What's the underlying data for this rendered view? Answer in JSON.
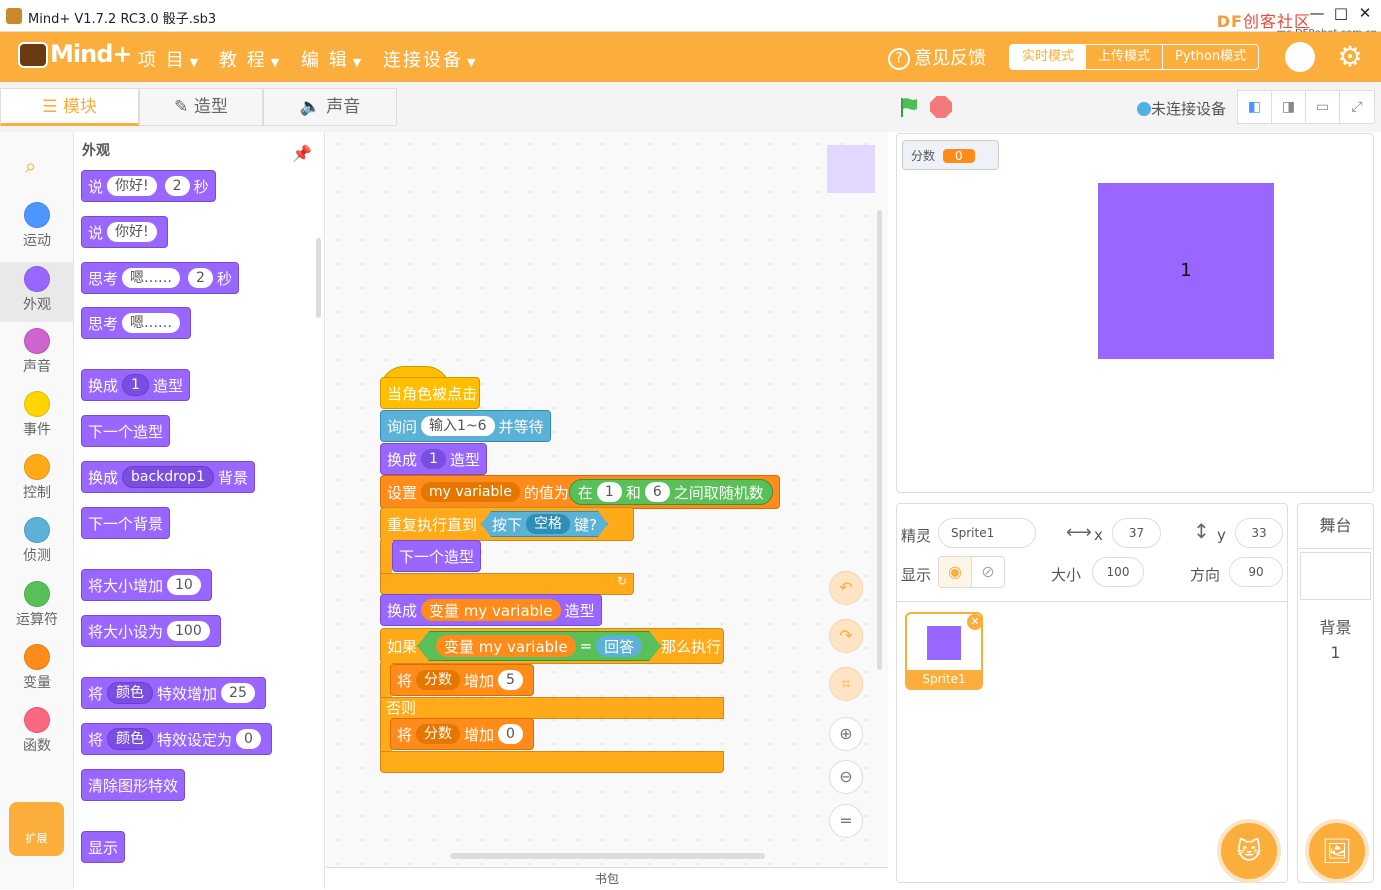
{
  "window": {
    "title": "Mind+ V1.7.2 RC3.0   骰子.sb3",
    "watermark_df": "DF",
    "watermark_cn": "创客社区",
    "watermark_url": "mc.DFRobot.com.cn"
  },
  "menubar": {
    "logo": "Mind+",
    "items": [
      "项 目",
      "教 程",
      "编 辑",
      "连接设备"
    ],
    "feedback": "意见反馈",
    "modes": [
      "实时模式",
      "上传模式",
      "Python模式"
    ],
    "active_mode": "实时模式"
  },
  "tabs": [
    "模块",
    "造型",
    "声音"
  ],
  "connection": "未连接设备",
  "categories": [
    {
      "label": "运动",
      "color": "#4c97ff"
    },
    {
      "label": "外观",
      "color": "#9966ff"
    },
    {
      "label": "声音",
      "color": "#cf63cf"
    },
    {
      "label": "事件",
      "color": "#ffd500"
    },
    {
      "label": "控制",
      "color": "#ffab19"
    },
    {
      "label": "侦测",
      "color": "#5cb1d6"
    },
    {
      "label": "运算符",
      "color": "#59c059"
    },
    {
      "label": "变量",
      "color": "#ff8c1a"
    },
    {
      "label": "函数",
      "color": "#ff6680"
    }
  ],
  "extensions_label": "扩展",
  "palette": {
    "title": "外观",
    "b1": {
      "a": "说",
      "v1": "你好!",
      "v2": "2",
      "b": "秒"
    },
    "b2": {
      "a": "说",
      "v1": "你好!"
    },
    "b3": {
      "a": "思考",
      "v1": "嗯……",
      "v2": "2",
      "b": "秒"
    },
    "b4": {
      "a": "思考",
      "v1": "嗯……"
    },
    "b5": {
      "a": "换成",
      "v1": "1",
      "b": "造型"
    },
    "b6": {
      "a": "下一个造型"
    },
    "b7": {
      "a": "换成",
      "v1": "backdrop1",
      "b": "背景"
    },
    "b8": {
      "a": "下一个背景"
    },
    "b9": {
      "a": "将大小增加",
      "v1": "10"
    },
    "b10": {
      "a": "将大小设为",
      "v1": "100"
    },
    "b11": {
      "a": "将",
      "v1": "颜色",
      "b": "特效增加",
      "v2": "25"
    },
    "b12": {
      "a": "将",
      "v1": "颜色",
      "b": "特效设定为",
      "v2": "0"
    },
    "b13": {
      "a": "清除图形特效"
    },
    "b14": {
      "a": "显示"
    }
  },
  "script": {
    "hat": "当角色被点击",
    "ask": {
      "a": "询问",
      "v": "输入1~6",
      "b": "并等待"
    },
    "switch1": {
      "a": "换成",
      "v": "1",
      "b": "造型"
    },
    "set": {
      "a": "设置",
      "var": "my variable",
      "b": "的值为",
      "r1": "在",
      "n1": "1",
      "r2": "和",
      "n2": "6",
      "r3": "之间取随机数"
    },
    "repeat": {
      "a": "重复执行直到",
      "k": "按下",
      "key": "空格",
      "q": "键?"
    },
    "next": "下一个造型",
    "switch2": {
      "a": "换成",
      "var": "变量 my variable",
      "b": "造型"
    },
    "if": {
      "a": "如果",
      "var": "变量 my variable",
      "eq": "=",
      "ans": "回答",
      "b": "那么执行"
    },
    "change1": {
      "a": "将",
      "var": "分数",
      "b": "增加",
      "v": "5"
    },
    "else": "否则",
    "change2": {
      "a": "将",
      "var": "分数",
      "b": "增加",
      "v": "0"
    }
  },
  "bag": "书包",
  "stage": {
    "monitor_label": "分数",
    "monitor_value": "0",
    "sprite_text": "1"
  },
  "sprite_info": {
    "sprite_label": "精灵",
    "sprite_name": "Sprite1",
    "x_label": "x",
    "x": "37",
    "y_label": "y",
    "y": "33",
    "show_label": "显示",
    "size_label": "大小",
    "size": "100",
    "dir_label": "方向",
    "dir": "90",
    "thumb_name": "Sprite1"
  },
  "stage_pane": {
    "title": "舞台",
    "backdrop_label": "背景",
    "backdrop_count": "1"
  }
}
